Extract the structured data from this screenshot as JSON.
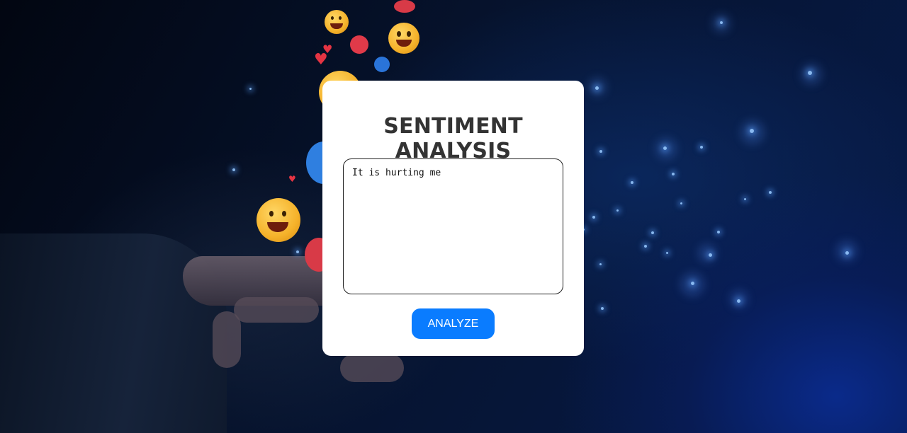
{
  "page": {
    "title": "SENTIMENT ANALYSIS"
  },
  "input": {
    "value": "It is hurting me"
  },
  "button": {
    "label": "ANALYZE"
  },
  "colors": {
    "button_bg": "#0a7cff",
    "title": "#333333",
    "card_bg": "#ffffff"
  },
  "icons": [
    "laughing-emoji-icon",
    "heart-icon",
    "like-icon"
  ]
}
